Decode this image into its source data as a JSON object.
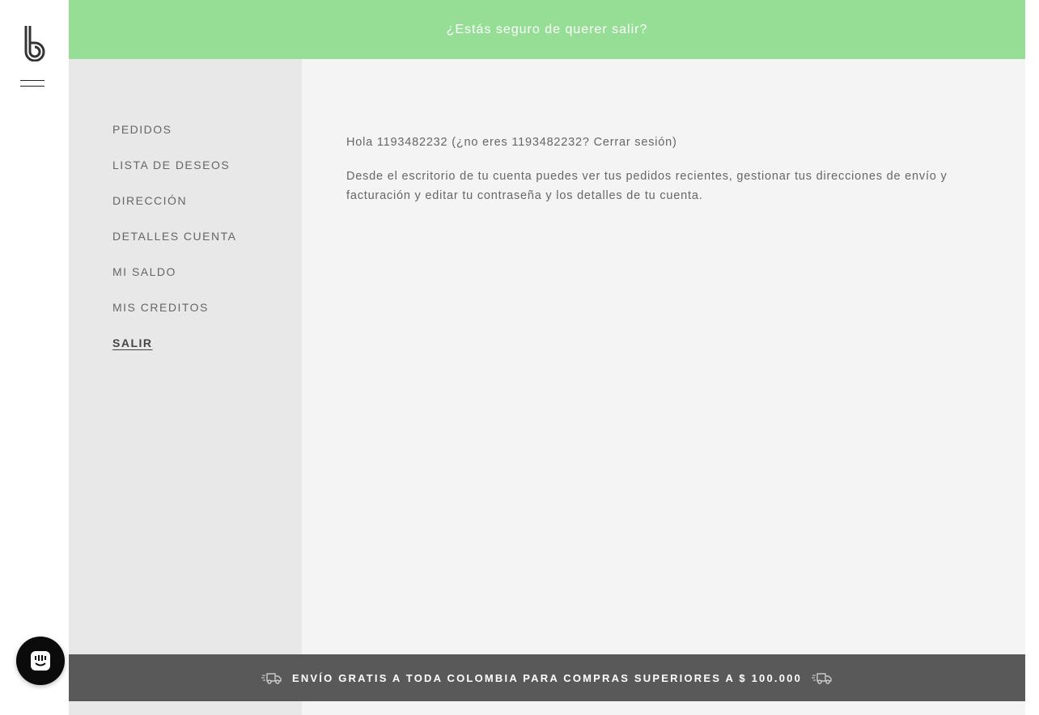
{
  "banner": {
    "message": "¿Estás seguro de querer salir?"
  },
  "sidebar_nav": {
    "items": [
      {
        "label": "PEDIDOS"
      },
      {
        "label": "LISTA DE DESEOS"
      },
      {
        "label": "DIRECCIÓN"
      },
      {
        "label": "DETALLES CUENTA"
      },
      {
        "label": "MI SALDO"
      },
      {
        "label": "MIS CREDITOS"
      },
      {
        "label": "SALIR",
        "active": true
      }
    ]
  },
  "content": {
    "greeting_prefix": "Hola 1193482232 (",
    "greeting_question": "¿no eres 1193482232? ",
    "logout_link": "Cerrar sesión",
    "greeting_suffix": ")",
    "description": "Desde el escritorio de tu cuenta puedes ver tus pedidos recientes, gestionar tus direcciones de envío y facturación y editar tu contraseña y los detalles de tu cuenta."
  },
  "shipping_bar": {
    "text": "ENVÍO GRATIS A TODA COLOMBIA PARA COMPRAS SUPERIORES A $ 100.000"
  },
  "icons": {
    "logo": "b-logo-icon",
    "menu": "hamburger-menu-icon",
    "truck": "truck-icon",
    "chat": "chat-icon"
  },
  "colors": {
    "banner": "#96de96",
    "sidebar": "#e8e8e8",
    "content": "#f4f4f4",
    "shipbar": "#595959"
  }
}
